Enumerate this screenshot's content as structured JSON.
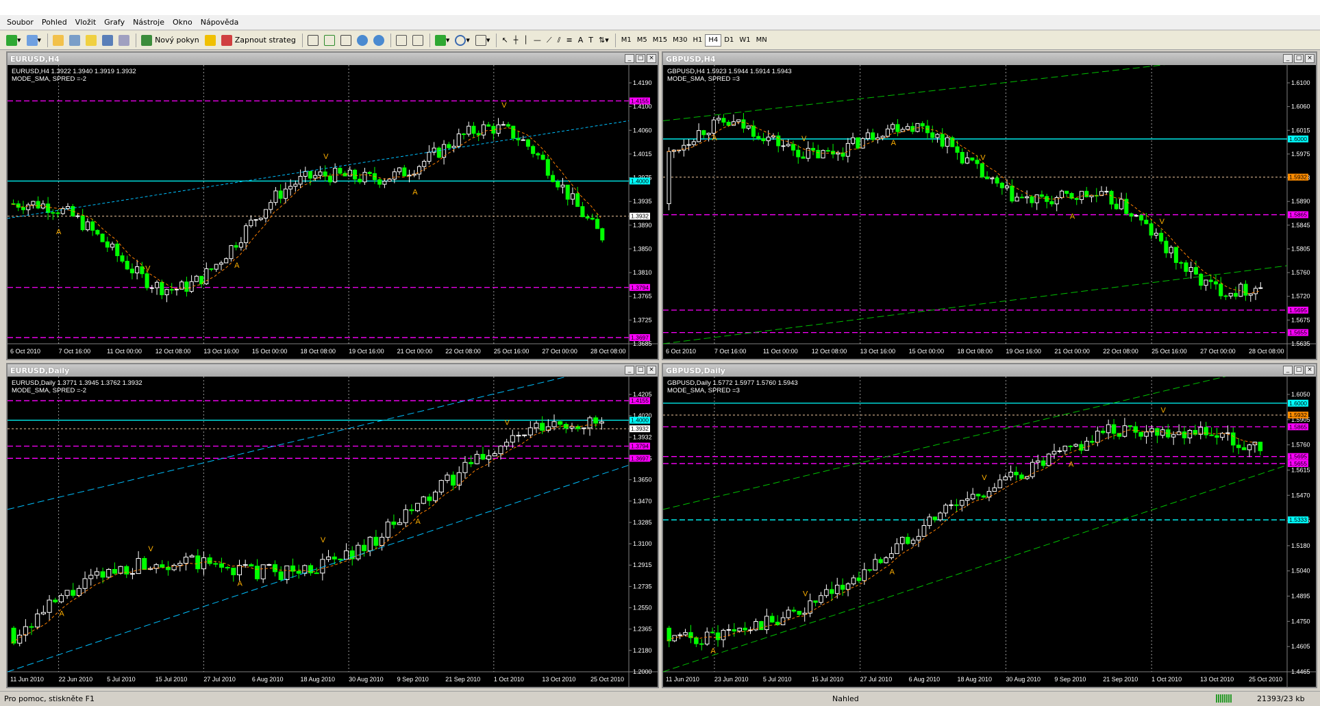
{
  "menu": [
    "Soubor",
    "Pohled",
    "Vložit",
    "Grafy",
    "Nástroje",
    "Okno",
    "Nápověda"
  ],
  "toolbar": {
    "new_order": "Nový pokyn",
    "autotrade": "Zapnout strateg",
    "timeframes": [
      "M1",
      "M5",
      "M15",
      "M30",
      "H1",
      "H4",
      "D1",
      "W1",
      "MN"
    ],
    "active_timeframe": "H4"
  },
  "windows": [
    {
      "title": "EURUSD,H4",
      "info1": "EURUSD,H4  1.3922 1.3940 1.3919 1.3932",
      "info2": "MODE_SMA, SPRED =-2",
      "price_labels": [
        "1.4190",
        "1.4100",
        "1.4060",
        "1.4015",
        "1.3975",
        "1.3935",
        "1.3890",
        "1.3850",
        "1.3810",
        "1.3765",
        "1.3725",
        "1.3685"
      ],
      "markers": [
        "1.4155",
        "1.4000",
        "1.3932",
        "1.3794",
        "1.3697"
      ],
      "time_labels": [
        "6 Oct 2010",
        "7 Oct 16:00",
        "11 Oct 00:00",
        "12 Oct 08:00",
        "13 Oct 16:00",
        "15 Oct 00:00",
        "18 Oct 08:00",
        "19 Oct 16:00",
        "21 Oct 00:00",
        "22 Oct 08:00",
        "25 Oct 16:00",
        "27 Oct 00:00",
        "28 Oct 08:00"
      ]
    },
    {
      "title": "GBPUSD,H4",
      "info1": "GBPUSD,H4  1.5923 1.5944 1.5914 1.5943",
      "info2": "MODE_SMA, SPRED =3",
      "price_labels": [
        "1.6100",
        "1.6060",
        "1.6015",
        "1.5975",
        "1.5943",
        "1.5890",
        "1.5845",
        "1.5805",
        "1.5760",
        "1.5720",
        "1.5675",
        "1.5635"
      ],
      "markers": [
        "1.6000",
        "1.5932",
        "1.5865",
        "1.5695",
        "1.5655"
      ],
      "time_labels": [
        "6 Oct 2010",
        "7 Oct 16:00",
        "11 Oct 00:00",
        "12 Oct 08:00",
        "13 Oct 16:00",
        "15 Oct 00:00",
        "18 Oct 08:00",
        "19 Oct 16:00",
        "21 Oct 00:00",
        "22 Oct 08:00",
        "25 Oct 16:00",
        "27 Oct 00:00",
        "28 Oct 08:00"
      ]
    },
    {
      "title": "EURUSD,Daily",
      "info1": "EURUSD,Daily  1.3771 1.3945 1.3762 1.3932",
      "info2": "MODE_SMA, SPRED =-2",
      "price_labels": [
        "1.4205",
        "1.4020",
        "1.3932",
        "1.3835",
        "1.3650",
        "1.3470",
        "1.3285",
        "1.3100",
        "1.2915",
        "1.2735",
        "1.2550",
        "1.2365",
        "1.2180",
        "1.2000"
      ],
      "markers": [
        "1.4155",
        "1.4000",
        "1.3932",
        "1.3794",
        "1.3697"
      ],
      "time_labels": [
        "11 Jun 2010",
        "22 Jun 2010",
        "5 Jul 2010",
        "15 Jul 2010",
        "27 Jul 2010",
        "6 Aug 2010",
        "18 Aug 2010",
        "30 Aug 2010",
        "9 Sep 2010",
        "21 Sep 2010",
        "1 Oct 2010",
        "13 Oct 2010",
        "25 Oct 2010"
      ]
    },
    {
      "title": "GBPUSD,Daily",
      "info1": "GBPUSD,Daily  1.5772 1.5977 1.5760 1.5943",
      "info2": "MODE_SMA, SPRED =3",
      "price_labels": [
        "1.6050",
        "1.5905",
        "1.5760",
        "1.5615",
        "1.5470",
        "1.5325",
        "1.5180",
        "1.5040",
        "1.4895",
        "1.4750",
        "1.4605",
        "1.4465"
      ],
      "markers": [
        "1.6000",
        "1.5932",
        "1.5865",
        "1.5695",
        "1.5655",
        "1.5333"
      ],
      "time_labels": [
        "11 Jun 2010",
        "23 Jun 2010",
        "5 Jul 2010",
        "15 Jul 2010",
        "27 Jul 2010",
        "6 Aug 2010",
        "18 Aug 2010",
        "30 Aug 2010",
        "9 Sep 2010",
        "21 Sep 2010",
        "1 Oct 2010",
        "13 Oct 2010",
        "25 Oct 2010"
      ]
    }
  ],
  "tabs": [
    "EURUSD,H4",
    "EURUSD,Daily",
    "GBPUSD,H4",
    "GBPUSD,Daily"
  ],
  "active_tab": "GBPUSD,H4",
  "status": {
    "help": "Pro pomoc, stiskněte F1",
    "profile": "Nahled",
    "traffic": "21393/23 kb"
  },
  "colors": {
    "bull": "#ffffff",
    "bear": "#00ff00",
    "sma": "#ff8000",
    "level_magenta": "#ff00ff",
    "level_cyan": "#00ffff",
    "channel_green": "#00c000",
    "channel_cyan": "#00c0ff",
    "marker_orange": "#ff8c00",
    "fractal": "#ffb000"
  }
}
